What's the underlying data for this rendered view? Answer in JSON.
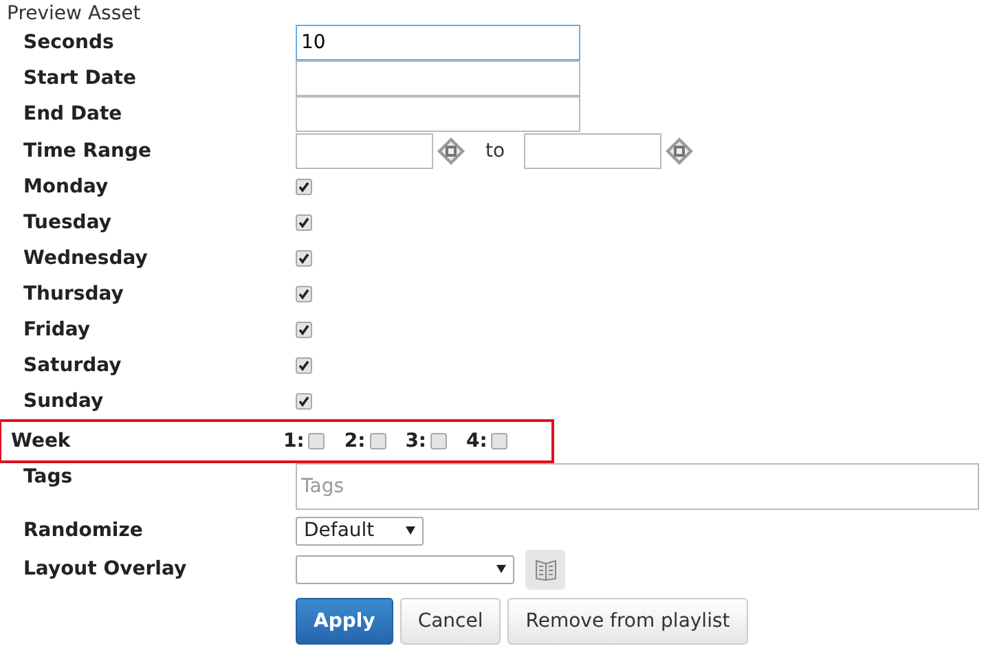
{
  "title": "Preview Asset",
  "rows": [
    {
      "kind": "text",
      "label": "Seconds",
      "value": "10",
      "focused": true
    },
    {
      "kind": "text",
      "label": "Start Date"
    },
    {
      "kind": "text",
      "label": "End Date"
    },
    {
      "kind": "time-range",
      "label": "Time Range",
      "separator": "to"
    },
    {
      "kind": "checkbox",
      "label": "Monday",
      "checked": true
    },
    {
      "kind": "checkbox",
      "label": "Tuesday",
      "checked": true
    },
    {
      "kind": "checkbox",
      "label": "Wednesday",
      "checked": true
    },
    {
      "kind": "checkbox",
      "label": "Thursday",
      "checked": true
    },
    {
      "kind": "checkbox",
      "label": "Friday",
      "checked": true
    },
    {
      "kind": "checkbox",
      "label": "Saturday",
      "checked": true
    },
    {
      "kind": "checkbox",
      "label": "Sunday",
      "checked": true
    },
    {
      "kind": "week",
      "label": "Week",
      "highlighted": true,
      "weeks": [
        {
          "label": "1:",
          "checked": false
        },
        {
          "label": "2:",
          "checked": false
        },
        {
          "label": "3:",
          "checked": false
        },
        {
          "label": "4:",
          "checked": false
        }
      ]
    },
    {
      "kind": "tags",
      "label": "Tags",
      "placeholder": "Tags"
    },
    {
      "kind": "select",
      "label": "Randomize",
      "value": "Default"
    },
    {
      "kind": "overlay",
      "label": "Layout Overlay"
    }
  ],
  "buttons": [
    {
      "label": "Apply",
      "kind": "primary"
    },
    {
      "label": "Cancel",
      "kind": "default"
    },
    {
      "label": "Remove from playlist",
      "kind": "default"
    }
  ]
}
